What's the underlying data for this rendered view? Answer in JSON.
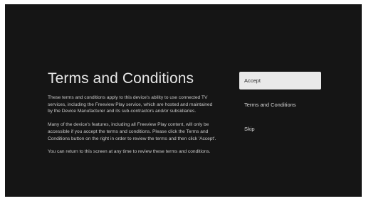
{
  "page": {
    "title": "Terms and Conditions",
    "paragraphs": [
      "These terms and conditions apply to this device's ability to use connected TV services, including the Freeview Play service, which are hosted and maintained by the Device Manufacturer and its sub-contractors and/or subsidiaries.",
      "Many of the device's features, including all Freeview Play content, will only be accessible if you accept the terms and conditions. Please click the Terms and Conditions button on the right in order to review the terms and then click 'Accept'.",
      "You can return to this screen at any time to review these terms and conditions."
    ]
  },
  "menu": {
    "items": [
      {
        "label": "Accept",
        "selected": true
      },
      {
        "label": "Terms and Conditions",
        "selected": false
      },
      {
        "label": "Skip",
        "selected": false
      }
    ]
  },
  "colors": {
    "background": "#151515",
    "selected_bg": "#e9e9e9",
    "text": "#c9c9c9"
  }
}
